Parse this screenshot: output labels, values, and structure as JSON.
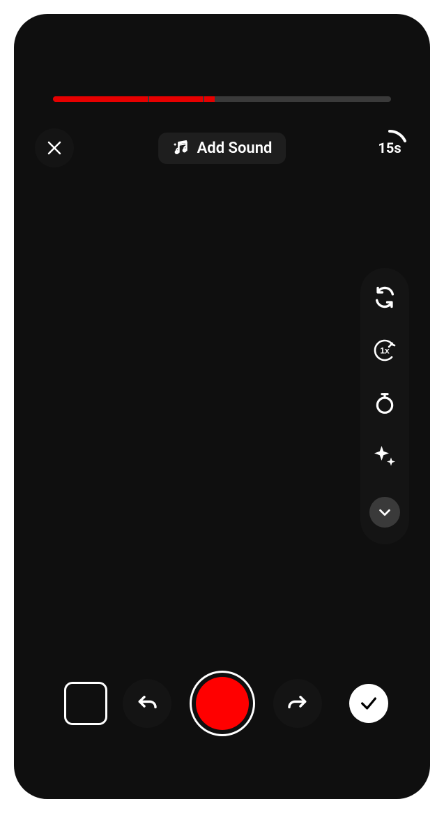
{
  "recording": {
    "progress_segments": [
      28,
      16,
      3
    ],
    "total_duration_label": "15s"
  },
  "top": {
    "add_sound_label": "Add Sound"
  },
  "side_tools": {
    "speed_label": "1x"
  },
  "colors": {
    "accent": "#f00",
    "progress_track": "#3a3a3a",
    "bg": "#0f0f0f",
    "bubble": "#141414",
    "pill": "#1e1e1e"
  }
}
